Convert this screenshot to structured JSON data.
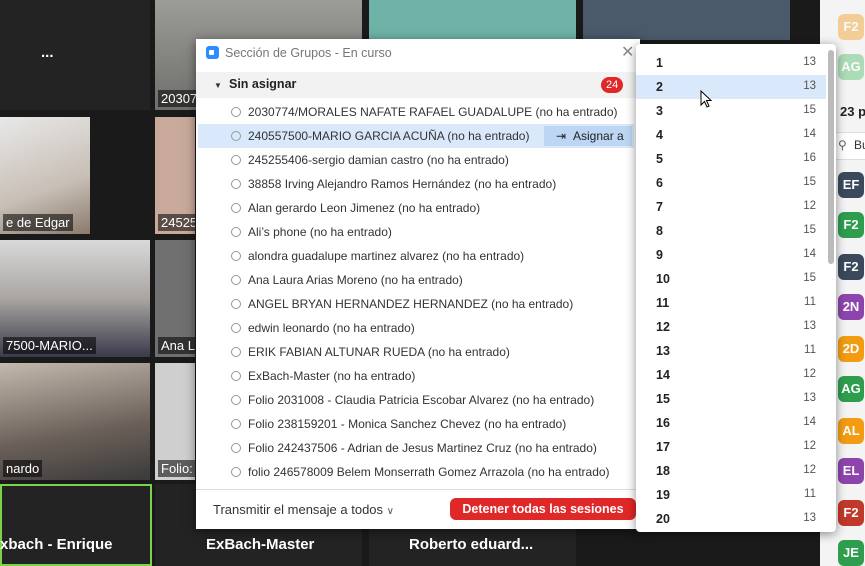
{
  "tiles": [
    {
      "label": "..."
    },
    {
      "label": "20307"
    },
    {
      "label": "e de Edgar"
    },
    {
      "label": "24525"
    },
    {
      "label": "7500-MARIO..."
    },
    {
      "label": "Ana La"
    },
    {
      "label": "nardo"
    },
    {
      "label": "Folio: 2"
    }
  ],
  "bottom_names": [
    "xbach - Enrique",
    "ExBach-Master",
    "Roberto  eduard..."
  ],
  "right_panel": {
    "avatars": [
      {
        "text": "F2",
        "color": "#f2a93b"
      },
      {
        "text": "AG",
        "color": "#8fd19e"
      },
      {
        "text": "EF",
        "color": "#3a4a5c"
      },
      {
        "text": "F2",
        "color": "#2e9e4e"
      },
      {
        "text": "F2",
        "color": "#3a4a5c"
      },
      {
        "text": "2N",
        "color": "#8e44ad"
      },
      {
        "text": "2D",
        "color": "#f39c12"
      },
      {
        "text": "AG",
        "color": "#2e9e4e"
      },
      {
        "text": "AL",
        "color": "#f39c12"
      },
      {
        "text": "EL",
        "color": "#8e44ad"
      },
      {
        "text": "F2",
        "color": "#c0392b"
      },
      {
        "text": "JE",
        "color": "#2e9e4e"
      }
    ],
    "count_text": "23 p",
    "search_text": "Bu"
  },
  "dialog": {
    "title": "Sección de Grupos - En curso",
    "group_name": "Sin asignar",
    "group_count": "24",
    "assign_label": "Asignar a",
    "participants": [
      "2030774/MORALES NAFATE RAFAEL GUADALUPE (no ha entrado)",
      "240557500-MARIO GARCIA ACUÑA (no ha entrado)",
      "245255406-sergio damian castro (no ha entrado)",
      "38858 Irving Alejandro Ramos Hernández (no ha entrado)",
      "Alan gerardo Leon Jimenez (no ha entrado)",
      "Ali’s phone (no ha entrado)",
      "alondra guadalupe martinez alvarez (no ha entrado)",
      "Ana Laura Arias Moreno (no ha entrado)",
      "ANGEL BRYAN HERNANDEZ HERNANDEZ (no ha entrado)",
      "edwin leonardo (no ha entrado)",
      "ERIK FABIAN ALTUNAR RUEDA (no ha entrado)",
      "ExBach-Master (no ha entrado)",
      "Folio 2031008 - Claudia Patricia Escobar Alvarez (no ha entrado)",
      "Folio 238159201 - Monica Sanchez Chevez (no ha entrado)",
      "Folio 242437506 - Adrian de Jesus Martinez Cruz (no ha entrado)",
      "folio 246578009 Belem Monserrath Gomez Arrazola (no ha entrado)"
    ],
    "broadcast_label": "Transmitir el mensaje a todos",
    "stop_label": "Detener todas las sesiones"
  },
  "dropdown": {
    "items": [
      {
        "num": "1",
        "count": "13"
      },
      {
        "num": "2",
        "count": "13"
      },
      {
        "num": "3",
        "count": "15"
      },
      {
        "num": "4",
        "count": "14"
      },
      {
        "num": "5",
        "count": "16"
      },
      {
        "num": "6",
        "count": "15"
      },
      {
        "num": "7",
        "count": "12"
      },
      {
        "num": "8",
        "count": "15"
      },
      {
        "num": "9",
        "count": "14"
      },
      {
        "num": "10",
        "count": "15"
      },
      {
        "num": "11",
        "count": "11"
      },
      {
        "num": "12",
        "count": "13"
      },
      {
        "num": "13",
        "count": "11"
      },
      {
        "num": "14",
        "count": "12"
      },
      {
        "num": "15",
        "count": "13"
      },
      {
        "num": "16",
        "count": "14"
      },
      {
        "num": "17",
        "count": "12"
      },
      {
        "num": "18",
        "count": "12"
      },
      {
        "num": "19",
        "count": "11"
      },
      {
        "num": "20",
        "count": "13"
      }
    ]
  }
}
